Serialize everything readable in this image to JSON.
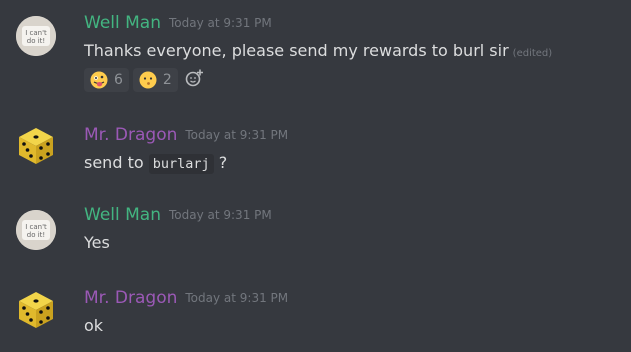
{
  "messages": [
    {
      "author": "Well Man",
      "timestamp": "Today at 9:31 PM",
      "text": "Thanks everyone, please send my rewards to burl sir",
      "edited": "(edited)",
      "avatar_text": "I can't do it!",
      "reactions": [
        {
          "icon": "tongue-out-emoji",
          "count": "6"
        },
        {
          "icon": "whistling-face-emoji",
          "count": "2"
        }
      ],
      "name_color": "#43b581"
    },
    {
      "author": "Mr. Dragon",
      "timestamp": "Today at 9:31 PM",
      "text_before": "send to",
      "code": "burlarj",
      "text_after": "?",
      "name_color": "#9b59b6"
    },
    {
      "author": "Well Man",
      "timestamp": "Today at 9:31 PM",
      "text": "Yes",
      "avatar_text": "I can't do it!",
      "name_color": "#43b581"
    },
    {
      "author": "Mr. Dragon",
      "timestamp": "Today at 9:31 PM",
      "text": "ok",
      "name_color": "#9b59b6"
    }
  ],
  "colors": {
    "background": "#36393f",
    "text": "#dcddde",
    "muted": "#72767d",
    "reaction_bg": "#3e4147"
  },
  "icons": {
    "add_reaction": "add-reaction-icon",
    "dice_avatar": "dice-avatar",
    "note_avatar": "note-avatar"
  }
}
